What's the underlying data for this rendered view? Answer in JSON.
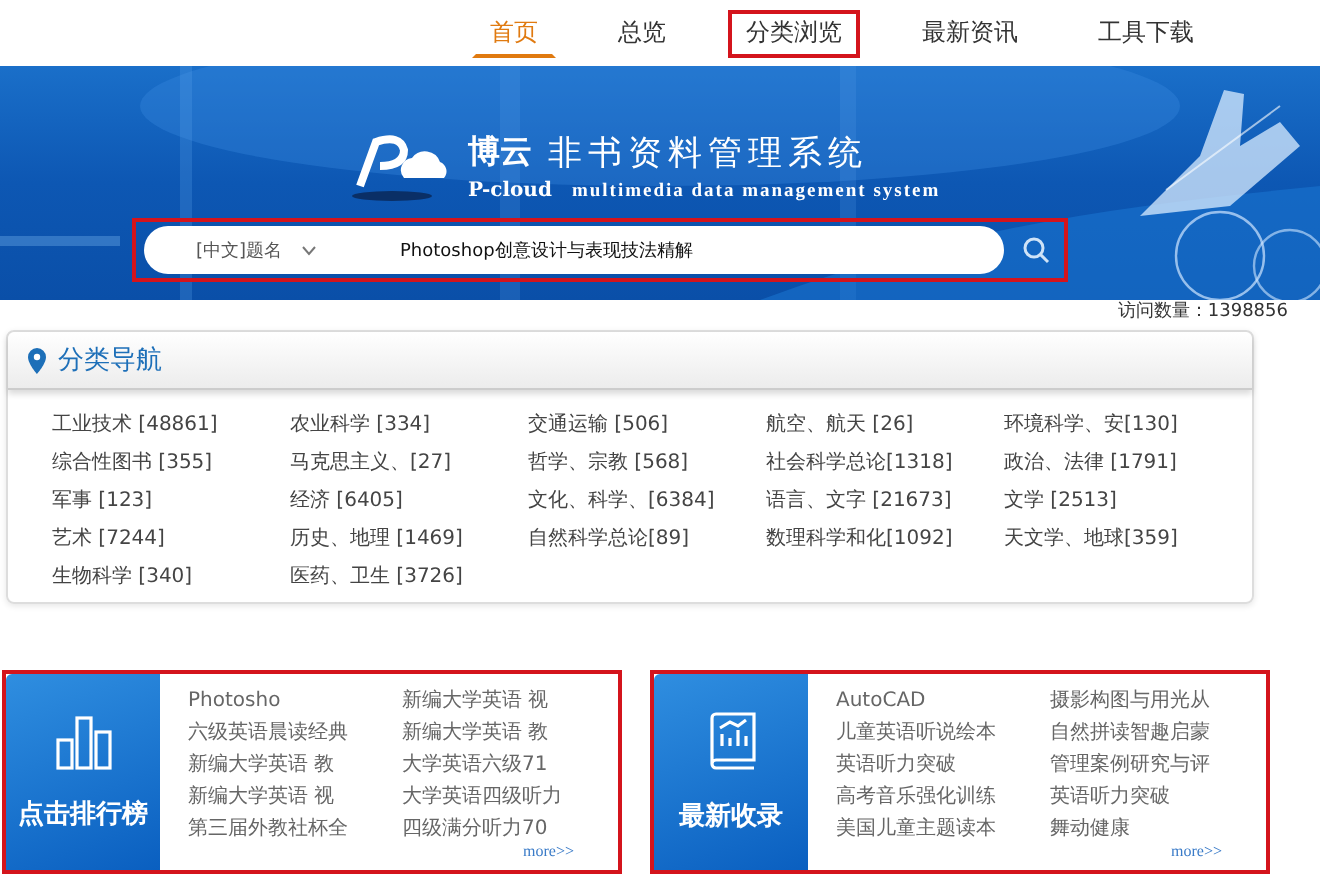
{
  "nav": [
    {
      "label": "首页",
      "selected": true,
      "highlighted": false
    },
    {
      "label": "总览",
      "selected": false,
      "highlighted": false
    },
    {
      "label": "分类浏览",
      "selected": false,
      "highlighted": true
    },
    {
      "label": "最新资讯",
      "selected": false,
      "highlighted": false
    },
    {
      "label": "工具下载",
      "selected": false,
      "highlighted": false
    }
  ],
  "banner": {
    "brand": "博云",
    "brand_latin": "P-cloud",
    "title": "非书资料管理系统",
    "subtitle": "multimedia data management system"
  },
  "search": {
    "highlighted": true,
    "field": "[中文]题名",
    "value": "Photoshop创意设计与表现技法精解"
  },
  "visits": "访问数量：1398856",
  "categories": {
    "title": "分类导航",
    "items": [
      "工业技术 [48861]",
      "农业科学 [334]",
      "交通运输 [506]",
      "航空、航天 [26]",
      "环境科学、安[130]",
      "综合性图书 [355]",
      "马克思主义、[27]",
      "哲学、宗教 [568]",
      "社会科学总论[1318]",
      "政治、法律 [1791]",
      "军事 [123]",
      "经济 [6405]",
      "文化、科学、[6384]",
      "语言、文字 [21673]",
      "文学 [2513]",
      "艺术 [7244]",
      "历史、地理 [1469]",
      "自然科学总论[89]",
      "数理科学和化[1092]",
      "天文学、地球[359]",
      "生物科学 [340]",
      "医药、卫生 [3726]"
    ]
  },
  "panels": [
    {
      "kind": "ranking",
      "highlighted": true,
      "title": "点击排行榜",
      "more": "more>>",
      "items": [
        "Photosho",
        "新编大学英语 视",
        "六级英语晨读经典",
        "新编大学英语 教",
        "新编大学英语 教",
        "大学英语六级71",
        "新编大学英语 视",
        "大学英语四级听力",
        "第三届外教社杯全",
        "四级满分听力70"
      ]
    },
    {
      "kind": "latest",
      "highlighted": true,
      "title": "最新收录",
      "more": "more>>",
      "items": [
        "AutoCAD",
        "摄影构图与用光从",
        "儿童英语听说绘本",
        "自然拼读智趣启蒙",
        "英语听力突破",
        "管理案例研究与评",
        "高考音乐强化训练",
        "英语听力突破",
        "美国儿童主题读本",
        "舞动健康"
      ]
    }
  ]
}
